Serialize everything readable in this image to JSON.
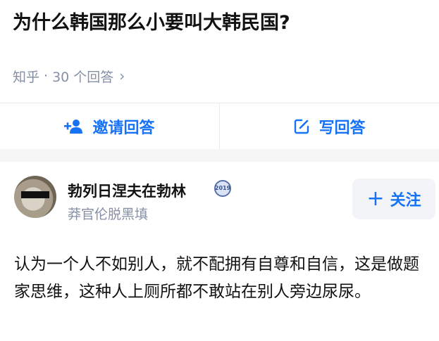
{
  "question": {
    "title": "为什么韩国那么小要叫大韩民国?"
  },
  "meta": {
    "source": "知乎",
    "separator": "·",
    "answer_count": "30 个回答",
    "chevron": "›"
  },
  "actions": {
    "invite_label": "邀请回答",
    "write_label": "写回答",
    "accent": "#1772f6"
  },
  "answer": {
    "author_name": "勃列日涅夫在勃林",
    "badge_text": "2019",
    "author_bio": "莽官伦脱黑填",
    "follow_label": "关注",
    "follow_plus": "+",
    "content": "认为一个人不如别人，就不配拥有自尊和自信，这是做题家思维，这种人上厕所都不敢站在别人旁边尿尿。"
  }
}
